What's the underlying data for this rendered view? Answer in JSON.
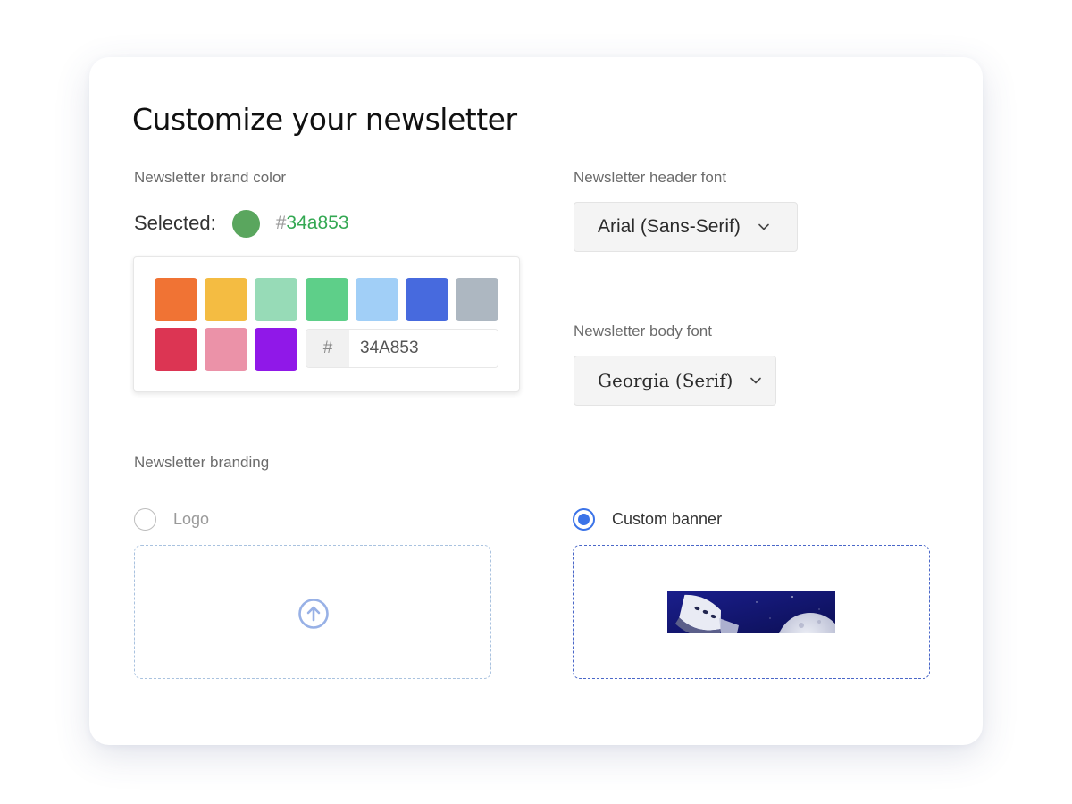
{
  "title": "Customize your newsletter",
  "brand_color": {
    "label": "Newsletter brand color",
    "selected_label": "Selected:",
    "selected_hash": "#",
    "selected_value": "34a853",
    "selected_color": "#5aa65e",
    "hex_prefix": "#",
    "hex_input_value": "34A853",
    "swatches": [
      "#f07334",
      "#f4bc42",
      "#97dbb7",
      "#5ecf89",
      "#a1cff7",
      "#476ade",
      "#adb7c1",
      "#dc3553",
      "#eb92a8",
      "#9018e8"
    ]
  },
  "header_font": {
    "label": "Newsletter header font",
    "value": "Arial (Sans-Serif)"
  },
  "body_font": {
    "label": "Newsletter body font",
    "value": "Georgia (Serif)"
  },
  "branding": {
    "label": "Newsletter branding",
    "options": [
      {
        "label": "Logo",
        "checked": false
      },
      {
        "label": "Custom banner",
        "checked": true
      }
    ]
  },
  "colors": {
    "accent": "#3b73e8",
    "selected_text": "#34a853"
  },
  "icons": {
    "upload": "upload-arrow-circle-icon",
    "chevron": "chevron-down-icon"
  }
}
